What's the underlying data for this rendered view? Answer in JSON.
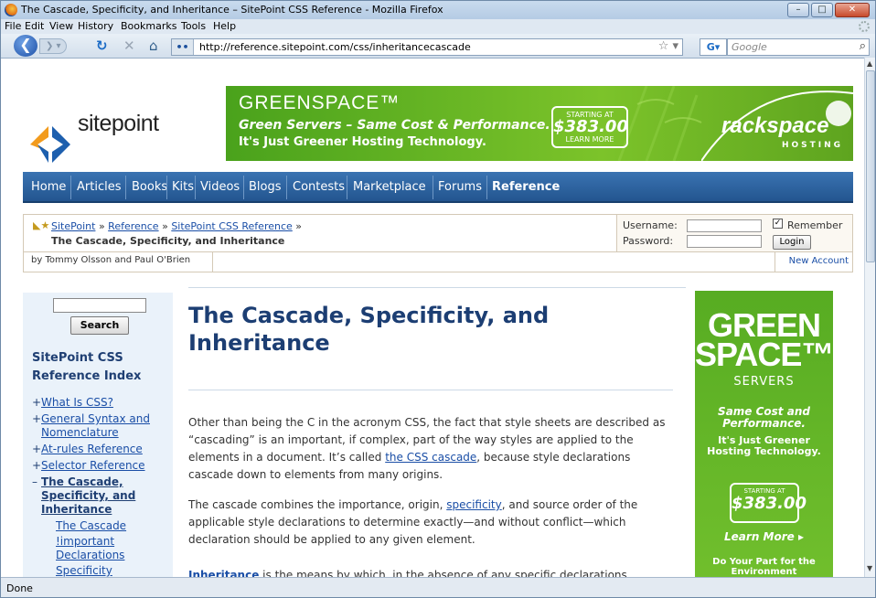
{
  "window": {
    "title": "The Cascade, Specificity, and Inheritance – SitePoint CSS Reference - Mozilla Firefox",
    "buttons": {
      "minimize": "–",
      "maximize": "□",
      "close": "✕"
    }
  },
  "menu": [
    "File",
    "Edit",
    "View",
    "History",
    "Bookmarks",
    "Tools",
    "Help"
  ],
  "toolbar": {
    "url": "http://reference.sitepoint.com/css/inheritancecascade",
    "search_engine": "G▾",
    "search_placeholder": "Google"
  },
  "status": "Done",
  "page": {
    "logo_text": "sitepoint",
    "banner": {
      "title": "GREENSPACE™",
      "line1": "Green Servers – Same Cost & Performance.",
      "line2": "It's Just Greener Hosting Technology.",
      "price_top": "STARTING AT",
      "price": "$383.00",
      "price_bottom": "LEARN MORE",
      "brand": "rackspace",
      "brand_sub": "HOSTING"
    },
    "nav": [
      "Home",
      "Articles",
      "Books",
      "Kits",
      "Videos",
      "Blogs",
      "Contests",
      "Marketplace",
      "Forums",
      "Reference"
    ],
    "breadcrumb": {
      "items": [
        "SitePoint",
        "Reference",
        "SitePoint CSS Reference"
      ],
      "sep": "»",
      "current": "The Cascade, Specificity, and Inheritance"
    },
    "login": {
      "username_label": "Username:",
      "password_label": "Password:",
      "remember_label": "Remember",
      "login_button": "Login",
      "new_account": "New Account"
    },
    "author": "by Tommy Olsson and Paul O'Brien",
    "sidebar": {
      "search_button": "Search",
      "index_title": "SitePoint CSS Reference Index",
      "items": [
        "What Is CSS?",
        "General Syntax and Nomenclature",
        "At-rules Reference",
        "Selector Reference"
      ],
      "current": "The Cascade, Specificity, and Inheritance",
      "subitems": [
        "The Cascade",
        "!important Declarations",
        "Specificity"
      ]
    },
    "main": {
      "title": "The Cascade, Specificity, and Inheritance",
      "p1_a": "Other than being the C in the acronym CSS, the fact that style sheets are described as “cascading” is an important, if complex, part of the way styles are applied to the elements in a document. It’s called ",
      "p1_link": "the CSS cascade",
      "p1_b": ", because style declarations cascade down to elements from many origins.",
      "p2_a": "The cascade combines the importance, origin, ",
      "p2_link": "specificity",
      "p2_b": ", and source order of the applicable style declarations to determine exactly—and without conflict—which declaration should be applied to any given element.",
      "p3_link": "Inheritance",
      "p3_b": " is the means by which, in the absence of any specific declarations"
    },
    "skyscraper": {
      "t1": "GREEN",
      "t2": "SPACE™",
      "t3": "SERVERS",
      "t4": "Same Cost and Performance.",
      "t5": "It's Just Greener Hosting Technology.",
      "price_top": "STARTING AT",
      "price": "$383.00",
      "learn": "Learn More ▸",
      "t8": "Do Your Part for the Environment"
    }
  }
}
